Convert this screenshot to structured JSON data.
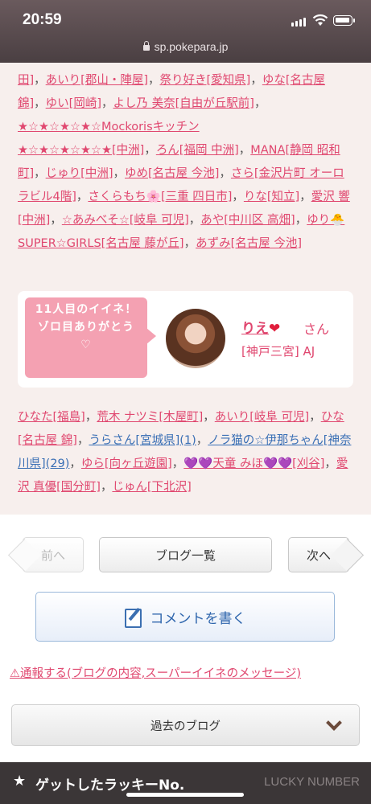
{
  "status": {
    "time": "20:59",
    "url": "sp.pokepara.jp"
  },
  "list1": [
    {
      "t": "田]",
      "c": "pink"
    },
    {
      "t": "あいり[郡山・陣屋]",
      "c": "pink"
    },
    {
      "t": "祭り好き[愛知県]",
      "c": "pink"
    },
    {
      "t": "ゆな[名古屋 錦]",
      "c": "pink"
    },
    {
      "t": "ゆい[岡崎]",
      "c": "pink"
    },
    {
      "t": "よし乃 美奈[自由が丘駅前]",
      "c": "pink"
    },
    {
      "t": "★☆★☆★☆★☆Mockorisキッチン",
      "c": "pink",
      "nosep": true,
      "br": true
    },
    {
      "t": "★☆★☆★☆★☆★[中洲]",
      "c": "pink"
    },
    {
      "t": "ろん[福岡 中洲]",
      "c": "pink"
    },
    {
      "t": "MANA[静岡 昭和町]",
      "c": "pink"
    },
    {
      "t": "じゅり[中洲]",
      "c": "pink"
    },
    {
      "t": "ゆめ[名古屋 今池]",
      "c": "pink"
    },
    {
      "t": "さら[金沢片町 オーロラビル4階]",
      "c": "pink"
    },
    {
      "t": "さくらもち🌸[三重 四日市]",
      "c": "pink"
    },
    {
      "t": "りな[知立]",
      "c": "pink"
    },
    {
      "t": "愛沢 響[中洲]",
      "c": "pink"
    },
    {
      "t": "☆あみべそ☆[岐阜 可児]",
      "c": "pink"
    },
    {
      "t": "あや[中川区 高畑]",
      "c": "pink"
    },
    {
      "t": "ゆり🐣SUPER☆GIRLS[名古屋 藤が丘]",
      "c": "pink"
    },
    {
      "t": "あずみ[名古屋 今池]",
      "c": "pink",
      "last": true
    }
  ],
  "card": {
    "bubble_line1": "11人目のイイネ！",
    "bubble_line2": "ゾロ目ありがとう",
    "bubble_heart": "♡",
    "user_name": "りえ",
    "user_heart": "❤",
    "suffix": "さん",
    "shop": "[神戸三宮] AJ"
  },
  "list2": [
    {
      "t": "ひなた[福島]",
      "c": "pink"
    },
    {
      "t": "荒木 ナツミ[木屋町]",
      "c": "pink"
    },
    {
      "t": "あいり[岐阜 可児]",
      "c": "pink"
    },
    {
      "t": "ひな[名古屋 錦]",
      "c": "pink"
    },
    {
      "t": "うらさん[宮城県](1)",
      "c": "blue"
    },
    {
      "t": "ノラ猫の☆伊那ちゃん[神奈川県](29)",
      "c": "blue"
    },
    {
      "t": "ゆら[向ヶ丘遊園]",
      "c": "pink"
    },
    {
      "t": "💜💜天童 みほ💜💜[刈谷]",
      "c": "pink"
    },
    {
      "t": "愛沢 真優[国分町]",
      "c": "pink"
    },
    {
      "t": "じゅん[下北沢]",
      "c": "pink",
      "last": true
    }
  ],
  "nav": {
    "prev": "前へ",
    "list": "ブログ一覧",
    "next": "次へ"
  },
  "comment": {
    "label": "コメントを書く"
  },
  "report": {
    "label": "⚠通報する(ブログの内容,スーパーイイネのメッセージ)"
  },
  "past": {
    "label": "過去のブログ"
  },
  "lucky": {
    "star": "★",
    "title": "ゲットしたラッキーNo.",
    "en": "LUCKY NUMBER"
  },
  "colors": {
    "pink": "#e0476f",
    "blue": "#3a6fb5",
    "bubble": "#f4a1b2"
  }
}
